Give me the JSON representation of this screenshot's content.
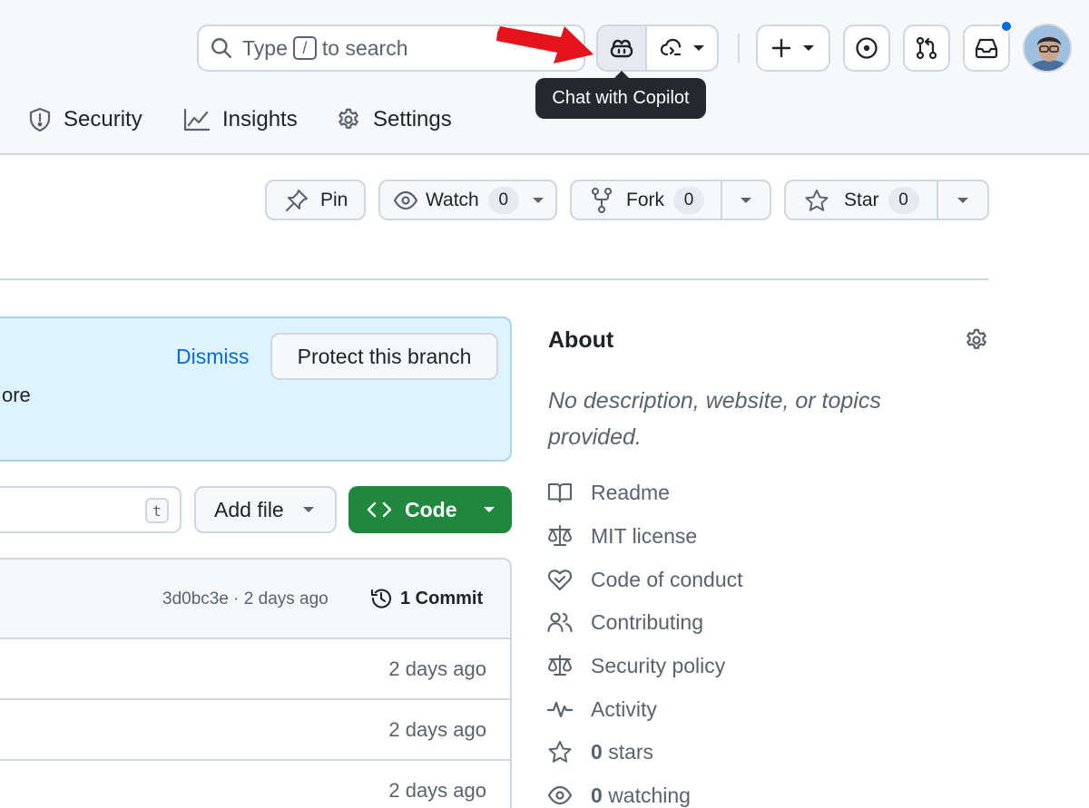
{
  "header": {
    "search_prefix": "Type",
    "search_key": "/",
    "search_suffix": "to search",
    "tooltip": "Chat with Copilot"
  },
  "repo_tabs": [
    {
      "label": "Security",
      "icon": "shield-icon"
    },
    {
      "label": "Insights",
      "icon": "graph-icon"
    },
    {
      "label": "Settings",
      "icon": "gear-icon"
    }
  ],
  "actions": {
    "pin": "Pin",
    "watch": "Watch",
    "watch_count": "0",
    "fork": "Fork",
    "fork_count": "0",
    "star": "Star",
    "star_count": "0"
  },
  "banner": {
    "text_fragment": "ore",
    "dismiss": "Dismiss",
    "protect": "Protect this branch"
  },
  "files": {
    "goto_key": "t",
    "add_file": "Add file",
    "code": "Code",
    "commit_hash_time": "3d0bc3e · 2 days ago",
    "commits": "1 Commit",
    "rows": [
      {
        "age": "2 days ago"
      },
      {
        "age": "2 days ago"
      },
      {
        "age": "2 days ago"
      }
    ]
  },
  "about": {
    "title": "About",
    "description": "No description, website, or topics provided.",
    "items": [
      {
        "label": "Readme",
        "icon": "book-icon"
      },
      {
        "label": "MIT license",
        "icon": "law-icon"
      },
      {
        "label": "Code of conduct",
        "icon": "code-of-conduct-icon"
      },
      {
        "label": "Contributing",
        "icon": "people-icon"
      },
      {
        "label": "Security policy",
        "icon": "law-icon"
      },
      {
        "label": "Activity",
        "icon": "pulse-icon"
      },
      {
        "count": "0",
        "label": "stars",
        "icon": "star-icon"
      },
      {
        "count": "0",
        "label": "watching",
        "icon": "eye-icon"
      }
    ]
  },
  "colors": {
    "accent_blue": "#0969da",
    "code_green": "#1f883d",
    "banner_bg": "#ddf4ff",
    "tooltip_bg": "#25292e",
    "arrow_red": "#e5131b"
  }
}
